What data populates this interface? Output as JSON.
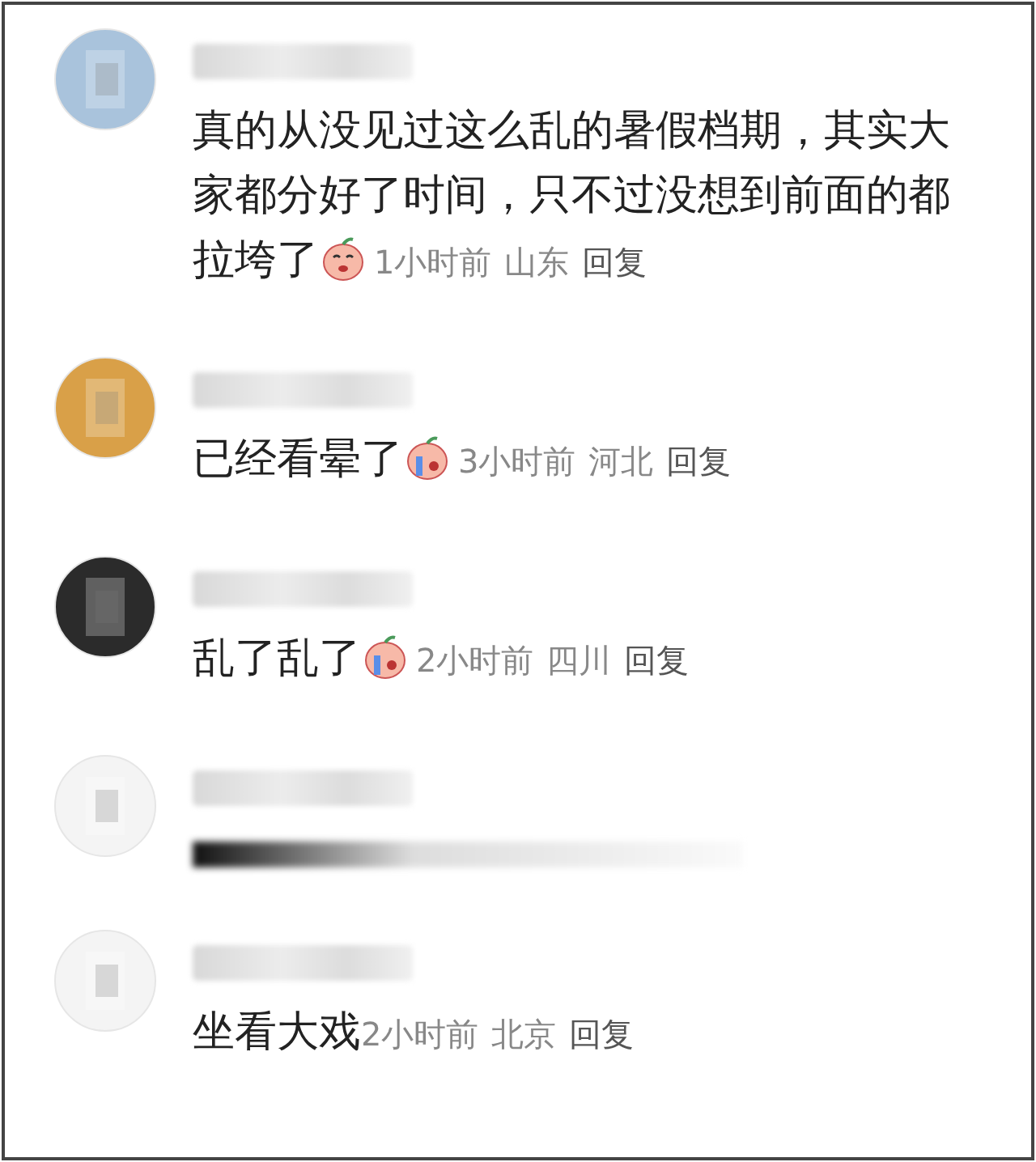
{
  "comments": [
    {
      "kind": "text",
      "color": "#a9c3dc",
      "text": "真的从没见过这么乱的暑假档期，其实大家都分好了时间，只不过没想到前面的都拉垮了",
      "emoji": {
        "kind": "smirk"
      },
      "time": "1小时前",
      "location": "山东",
      "reply": "回复"
    },
    {
      "kind": "text",
      "color": "#d9a048",
      "text": "已经看晕了",
      "emoji": {
        "kind": "cry"
      },
      "time": "3小时前",
      "location": "河北",
      "reply": "回复"
    },
    {
      "kind": "text",
      "color": "#2b2b2b",
      "text": "乱了乱了",
      "emoji": {
        "kind": "cry"
      },
      "time": "2小时前",
      "location": "四川",
      "reply": "回复"
    },
    {
      "kind": "redacted",
      "color": "#f4f4f4"
    },
    {
      "kind": "text",
      "color": "#f4f4f4",
      "text": "坐看大戏",
      "time": "2小时前",
      "location": "北京",
      "reply": "回复"
    }
  ]
}
